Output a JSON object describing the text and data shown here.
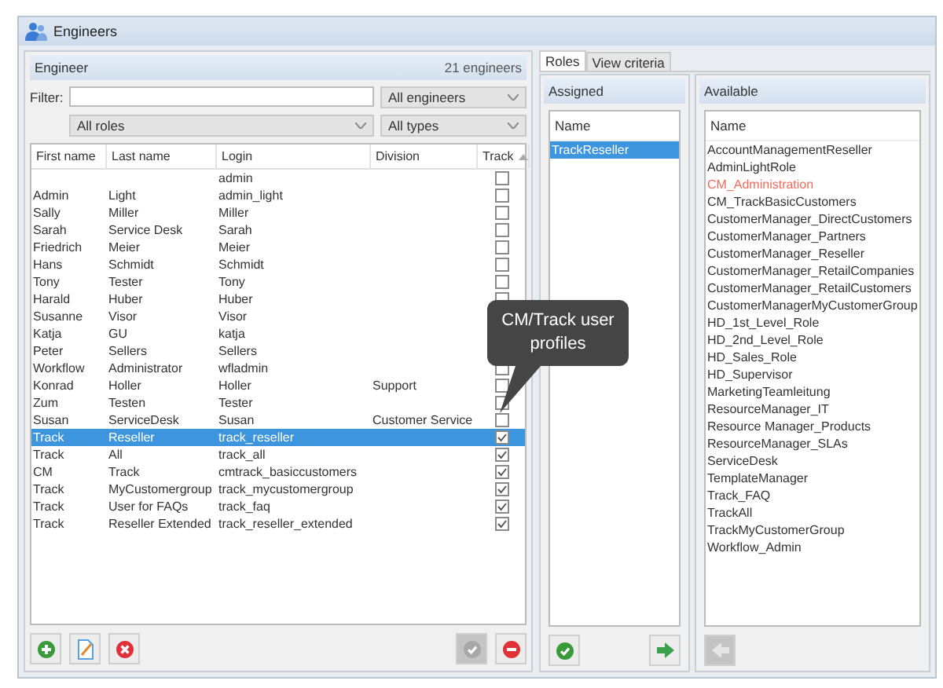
{
  "window": {
    "title": "Engineers"
  },
  "engineer_panel": {
    "title": "Engineer",
    "count": "21 engineers",
    "filter_label": "Filter:",
    "dropdowns": [
      "All engineers",
      "All roles",
      "All types"
    ],
    "columns": [
      "First name",
      "Last name",
      "Login",
      "Division",
      "Track"
    ],
    "rows": [
      {
        "first": "",
        "last": "",
        "login": "admin",
        "division": "",
        "checked": false,
        "selected": false
      },
      {
        "first": "Admin",
        "last": "Light",
        "login": "admin_light",
        "division": "",
        "checked": false,
        "selected": false
      },
      {
        "first": "Sally",
        "last": "Miller",
        "login": "Miller",
        "division": "",
        "checked": false,
        "selected": false
      },
      {
        "first": "Sarah",
        "last": "Service Desk",
        "login": "Sarah",
        "division": "",
        "checked": false,
        "selected": false
      },
      {
        "first": "Friedrich",
        "last": "Meier",
        "login": "Meier",
        "division": "",
        "checked": false,
        "selected": false
      },
      {
        "first": "Hans",
        "last": "Schmidt",
        "login": "Schmidt",
        "division": "",
        "checked": false,
        "selected": false
      },
      {
        "first": "Tony",
        "last": "Tester",
        "login": "Tony",
        "division": "",
        "checked": false,
        "selected": false
      },
      {
        "first": "Harald",
        "last": "Huber",
        "login": "Huber",
        "division": "",
        "checked": false,
        "selected": false
      },
      {
        "first": "Susanne",
        "last": "Visor",
        "login": "Visor",
        "division": "",
        "selected": false
      },
      {
        "first": "Katja",
        "last": "GU",
        "login": "katja",
        "division": "",
        "selected": false
      },
      {
        "first": "Peter",
        "last": "Sellers",
        "login": "Sellers",
        "division": "",
        "selected": false
      },
      {
        "first": "Workflow",
        "last": "Administrator",
        "login": "wfladmin",
        "division": "",
        "checked": false,
        "selected": false
      },
      {
        "first": "Konrad",
        "last": "Holler",
        "login": "Holler",
        "division": "Support",
        "checked": false,
        "selected": false
      },
      {
        "first": "Zum",
        "last": "Testen",
        "login": "Tester",
        "division": "",
        "checked": false,
        "selected": false
      },
      {
        "first": "Susan",
        "last": "ServiceDesk",
        "login": "Susan",
        "division": "Customer Service",
        "checked": false,
        "selected": false
      },
      {
        "first": "Track",
        "last": "Reseller",
        "login": "track_reseller",
        "division": "",
        "checked": true,
        "selected": true
      },
      {
        "first": "Track",
        "last": "All",
        "login": "track_all",
        "division": "",
        "checked": true,
        "selected": false
      },
      {
        "first": "CM",
        "last": "Track",
        "login": "cmtrack_basiccustomers",
        "division": "",
        "checked": true,
        "selected": false
      },
      {
        "first": "Track",
        "last": "MyCustomergroup",
        "login": "track_mycustomergroup",
        "division": "",
        "checked": true,
        "selected": false
      },
      {
        "first": "Track",
        "last": "User for FAQs",
        "login": "track_faq",
        "division": "",
        "checked": true,
        "selected": false
      },
      {
        "first": "Track",
        "last": "Reseller Extended",
        "login": "track_reseller_extended",
        "division": "",
        "checked": true,
        "selected": false
      }
    ],
    "buttons": [
      {
        "kind": "add",
        "disabled": false
      },
      {
        "kind": "edit",
        "disabled": false
      },
      {
        "kind": "delete",
        "disabled": false
      },
      {
        "kind": "confirm",
        "disabled": true
      },
      {
        "kind": "remove",
        "disabled": false
      }
    ]
  },
  "tooltip": "CM/Track user profiles",
  "tabs": [
    {
      "label": "Roles",
      "selected": true
    },
    {
      "label": "View criteria",
      "selected": false
    }
  ],
  "assigned": {
    "title": "Assigned",
    "column": "Name",
    "items": [
      {
        "name": "TrackReseller",
        "selected": true
      }
    ],
    "buttons": [
      {
        "kind": "confirm",
        "disabled": false
      },
      {
        "kind": "forward",
        "disabled": false
      }
    ]
  },
  "available": {
    "title": "Available",
    "column": "Name",
    "items": [
      {
        "name": "AccountManagementReseller",
        "color": "#333333"
      },
      {
        "name": "AdminLightRole",
        "color": "#333333"
      },
      {
        "name": "CM_Administration",
        "color": "#f26a5a"
      },
      {
        "name": "CM_TrackBasicCustomers",
        "color": "#333333"
      },
      {
        "name": "CustomerManager_DirectCustomers",
        "color": "#333333"
      },
      {
        "name": "CustomerManager_Partners",
        "color": "#333333"
      },
      {
        "name": "CustomerManager_Reseller",
        "color": "#333333"
      },
      {
        "name": "CustomerManager_RetailCompanies",
        "color": "#333333"
      },
      {
        "name": "CustomerManager_RetailCustomers",
        "color": "#333333"
      },
      {
        "name": "CustomerManagerMyCustomerGroup",
        "color": "#333333"
      },
      {
        "name": "HD_1st_Level_Role",
        "color": "#333333"
      },
      {
        "name": "HD_2nd_Level_Role",
        "color": "#333333"
      },
      {
        "name": "HD_Sales_Role",
        "color": "#333333"
      },
      {
        "name": "HD_Supervisor",
        "color": "#333333"
      },
      {
        "name": "MarketingTeamleitung",
        "color": "#333333"
      },
      {
        "name": "ResourceManager_IT",
        "color": "#333333"
      },
      {
        "name": "Resource Manager_Products",
        "color": "#333333"
      },
      {
        "name": "ResourceManager_SLAs",
        "color": "#333333"
      },
      {
        "name": "ServiceDesk",
        "color": "#333333"
      },
      {
        "name": "TemplateManager",
        "color": "#333333"
      },
      {
        "name": "Track_FAQ",
        "color": "#333333"
      },
      {
        "name": "TrackAll",
        "color": "#333333"
      },
      {
        "name": "TrackMyCustomerGroup",
        "color": "#333333"
      },
      {
        "name": "Workflow_Admin",
        "color": "#333333"
      }
    ],
    "buttons": [
      {
        "kind": "back",
        "disabled": true
      }
    ]
  }
}
